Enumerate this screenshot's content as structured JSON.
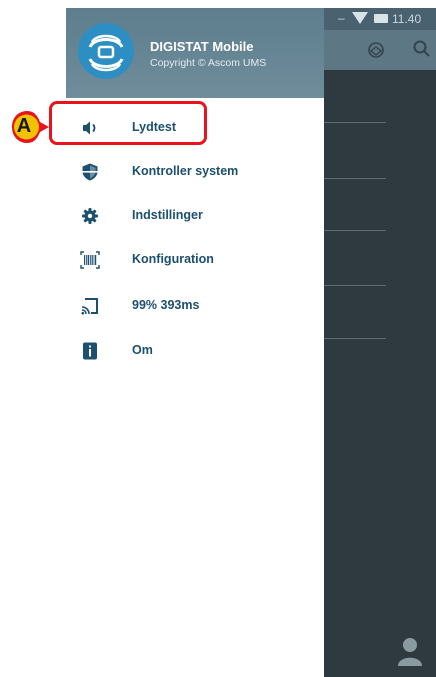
{
  "statusbar": {
    "dash": "–",
    "time": "11.40"
  },
  "drawer": {
    "app_name": "DIGISTAT Mobile",
    "copyright": "Copyright © Ascom UMS",
    "items": [
      {
        "label": "Lydtest",
        "icon": "speaker-icon"
      },
      {
        "label": "Kontroller system",
        "icon": "shield-icon"
      },
      {
        "label": "Indstillinger",
        "icon": "gear-icon"
      },
      {
        "label": "Konfiguration",
        "icon": "barcode-icon"
      },
      {
        "label": "99% 393ms",
        "icon": "cast-icon"
      },
      {
        "label": "Om",
        "icon": "info-icon"
      }
    ]
  },
  "callout": {
    "letter": "A",
    "color": "#e8131c",
    "badge_color": "#f2c200"
  },
  "colors": {
    "header": "#5e7d8d",
    "menu_text": "#1d4f6e",
    "background_app": "#2f3a40"
  }
}
